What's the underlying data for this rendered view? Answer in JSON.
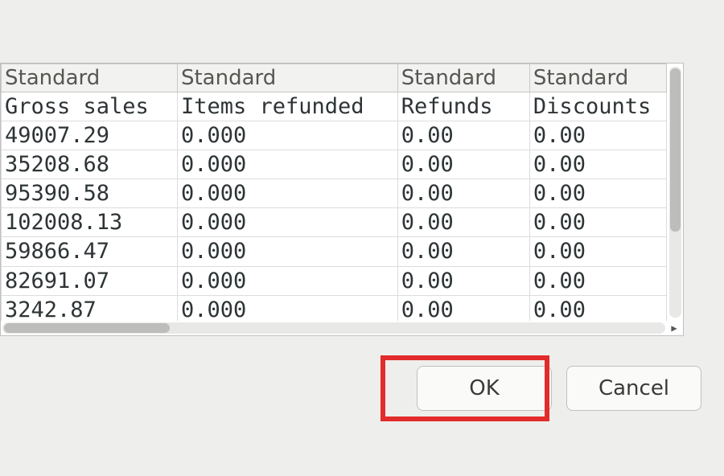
{
  "columns": [
    {
      "type": "Standard",
      "label": "Gross sales"
    },
    {
      "type": "Standard",
      "label": "Items refunded"
    },
    {
      "type": "Standard",
      "label": "Refunds"
    },
    {
      "type": "Standard",
      "label": "Discounts"
    }
  ],
  "rows": [
    {
      "gross_sales": "49007.29",
      "items_refunded": "0.000",
      "refunds": "0.00",
      "discounts": "0.00"
    },
    {
      "gross_sales": "35208.68",
      "items_refunded": "0.000",
      "refunds": "0.00",
      "discounts": "0.00"
    },
    {
      "gross_sales": "95390.58",
      "items_refunded": "0.000",
      "refunds": "0.00",
      "discounts": "0.00"
    },
    {
      "gross_sales": "102008.13",
      "items_refunded": "0.000",
      "refunds": "0.00",
      "discounts": "0.00"
    },
    {
      "gross_sales": "59866.47",
      "items_refunded": "0.000",
      "refunds": "0.00",
      "discounts": "0.00"
    },
    {
      "gross_sales": "82691.07",
      "items_refunded": "0.000",
      "refunds": "0.00",
      "discounts": "0.00"
    },
    {
      "gross_sales": "3242.87",
      "items_refunded": "0.000",
      "refunds": "0.00",
      "discounts": "0.00"
    }
  ],
  "buttons": {
    "ok": "OK",
    "cancel": "Cancel"
  }
}
